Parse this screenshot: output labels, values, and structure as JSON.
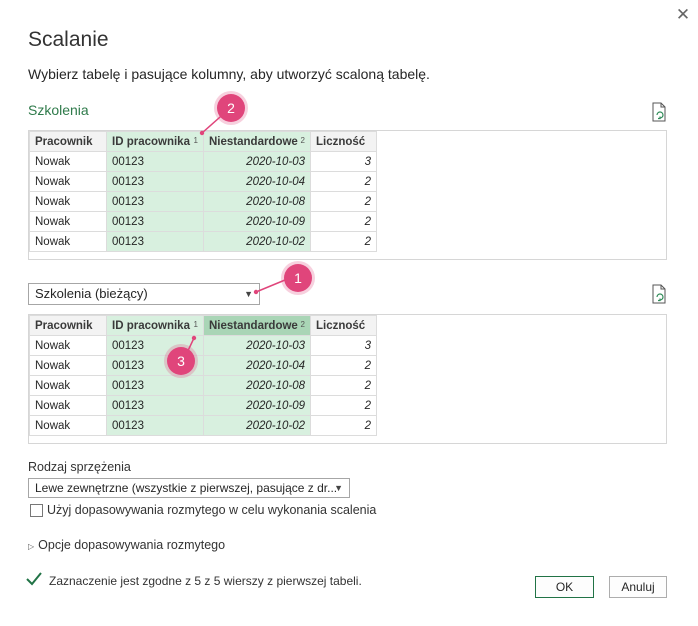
{
  "dialog": {
    "title": "Scalanie",
    "subtitle": "Wybierz tabelę i pasujące kolumny, aby utworzyć scaloną tabelę.",
    "close_glyph": "✕"
  },
  "first_table": {
    "label": "Szkolenia",
    "columns": [
      {
        "name": "Pracownik",
        "order": ""
      },
      {
        "name": "ID pracownika",
        "order": "1"
      },
      {
        "name": "Niestandardowe",
        "order": "2"
      },
      {
        "name": "Liczność",
        "order": ""
      }
    ],
    "rows": [
      [
        "Nowak",
        "00123",
        "2020-10-03",
        "3"
      ],
      [
        "Nowak",
        "00123",
        "2020-10-04",
        "2"
      ],
      [
        "Nowak",
        "00123",
        "2020-10-08",
        "2"
      ],
      [
        "Nowak",
        "00123",
        "2020-10-09",
        "2"
      ],
      [
        "Nowak",
        "00123",
        "2020-10-02",
        "2"
      ]
    ]
  },
  "second_table": {
    "selected": "Szkolenia (bieżący)",
    "columns": [
      {
        "name": "Pracownik",
        "order": ""
      },
      {
        "name": "ID pracownika",
        "order": "1"
      },
      {
        "name": "Niestandardowe",
        "order": "2"
      },
      {
        "name": "Liczność",
        "order": ""
      }
    ],
    "rows": [
      [
        "Nowak",
        "00123",
        "2020-10-03",
        "3"
      ],
      [
        "Nowak",
        "00123",
        "2020-10-04",
        "2"
      ],
      [
        "Nowak",
        "00123",
        "2020-10-08",
        "2"
      ],
      [
        "Nowak",
        "00123",
        "2020-10-09",
        "2"
      ],
      [
        "Nowak",
        "00123",
        "2020-10-02",
        "2"
      ]
    ]
  },
  "join": {
    "label": "Rodzaj sprzężenia",
    "selected": "Lewe zewnętrzne (wszystkie z pierwszej, pasujące z dr..."
  },
  "fuzzy": {
    "checkbox_label": "Użyj dopasowywania rozmytego w celu wykonania scalenia",
    "checked": false,
    "options_label": "Opcje dopasowywania rozmytego"
  },
  "status": {
    "text": "Zaznaczenie jest zgodne z 5 z 5 wierszy z pierwszej tabeli."
  },
  "buttons": {
    "ok": "OK",
    "cancel": "Anuluj"
  },
  "callouts": [
    "1",
    "2",
    "3"
  ],
  "colors": {
    "accent_green": "#217346",
    "selected_column": "#d8f0df",
    "selected_header": "#a9d5b6",
    "callout": "#e0457b"
  }
}
